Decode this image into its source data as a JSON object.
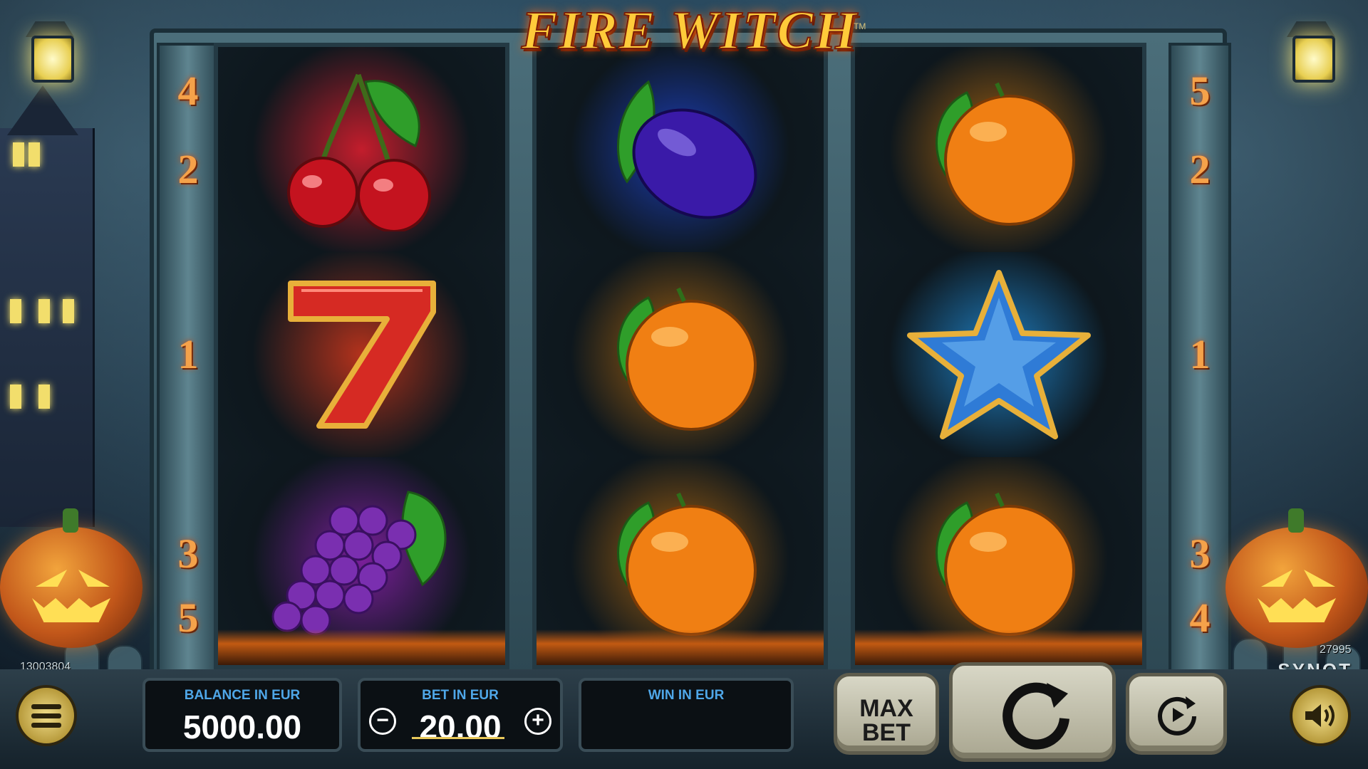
{
  "game": {
    "title": "FIRE WITCH",
    "trademark": "TM",
    "provider": "SYNOT",
    "session_id": "13003804",
    "game_id": "27995"
  },
  "paylines": {
    "left": [
      "4",
      "2",
      "1",
      "3",
      "5"
    ],
    "right": [
      "5",
      "2",
      "1",
      "3",
      "4"
    ]
  },
  "reels": [
    [
      "cherry-icon",
      "seven-icon",
      "grapes-icon"
    ],
    [
      "plum-icon",
      "orange-icon",
      "orange-icon"
    ],
    [
      "orange-icon",
      "star-icon",
      "orange-icon"
    ]
  ],
  "reel_glow_colors": [
    [
      "#c31d2c",
      "#b3321c",
      "#7a1f9a"
    ],
    [
      "#1b3cb3",
      "#a5620f",
      "#a5620f"
    ],
    [
      "#a5620f",
      "#1f7fc2",
      "#a5620f"
    ]
  ],
  "controls": {
    "balance_label": "BALANCE IN EUR",
    "balance_value": "5000.00",
    "bet_label": "BET IN EUR",
    "bet_value": "20.00",
    "win_label": "WIN IN EUR",
    "win_value": "",
    "maxbet_line1": "MAX",
    "maxbet_line2": "BET",
    "minus": "−",
    "plus": "+"
  }
}
